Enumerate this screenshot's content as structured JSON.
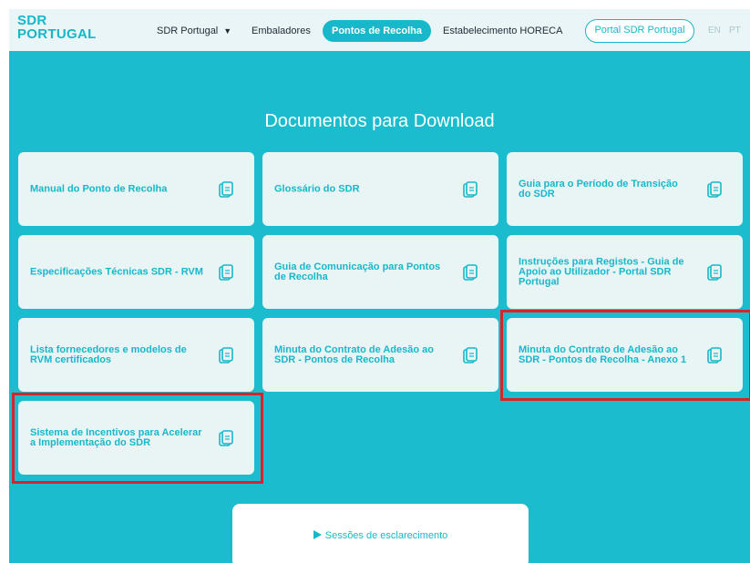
{
  "brand": {
    "line1": "SDR",
    "line2": "PORTUGAL"
  },
  "nav": {
    "dropdown_label": "SDR Portugal",
    "embaladores": "Embaladores",
    "pontos": "Pontos de Recolha",
    "horeca": "Estabelecimento HORECA",
    "portal": "Portal SDR Portugal",
    "lang_en": "EN",
    "lang_pt": "PT"
  },
  "section_title": "Documentos para Download",
  "documents": [
    {
      "label": "Manual do Ponto de Recolha",
      "icon": "document-icon"
    },
    {
      "label": "Glossário do SDR",
      "icon": "document-icon"
    },
    {
      "label": "Guia para o Período de Transição do SDR",
      "icon": "document-icon"
    },
    {
      "label": "Especificações Técnicas SDR - RVM",
      "icon": "document-icon"
    },
    {
      "label": "Guia de Comunicação para Pontos de Recolha",
      "icon": "document-icon"
    },
    {
      "label": "Instruções para Registos - Guia de Apoio ao Utilizador - Portal SDR Portugal",
      "icon": "document-icon"
    },
    {
      "label": "Lista fornecedores e modelos de RVM certificados",
      "icon": "document-icon"
    },
    {
      "label": "Minuta do Contrato de Adesão ao SDR - Pontos de Recolha",
      "icon": "document-icon"
    },
    {
      "label": "Minuta do Contrato de Adesão ao SDR - Pontos de Recolha - Anexo 1",
      "icon": "document-icon"
    },
    {
      "label": "Sistema de Incentivos para Acelerar a Implementação do SDR",
      "icon": "document-icon"
    }
  ],
  "session_button": {
    "label": "Sessões de esclarecimento",
    "icon": "play-icon"
  },
  "colors": {
    "accent": "#17b8ca",
    "background": "#1bbccd",
    "highlight": "#d8232a"
  }
}
